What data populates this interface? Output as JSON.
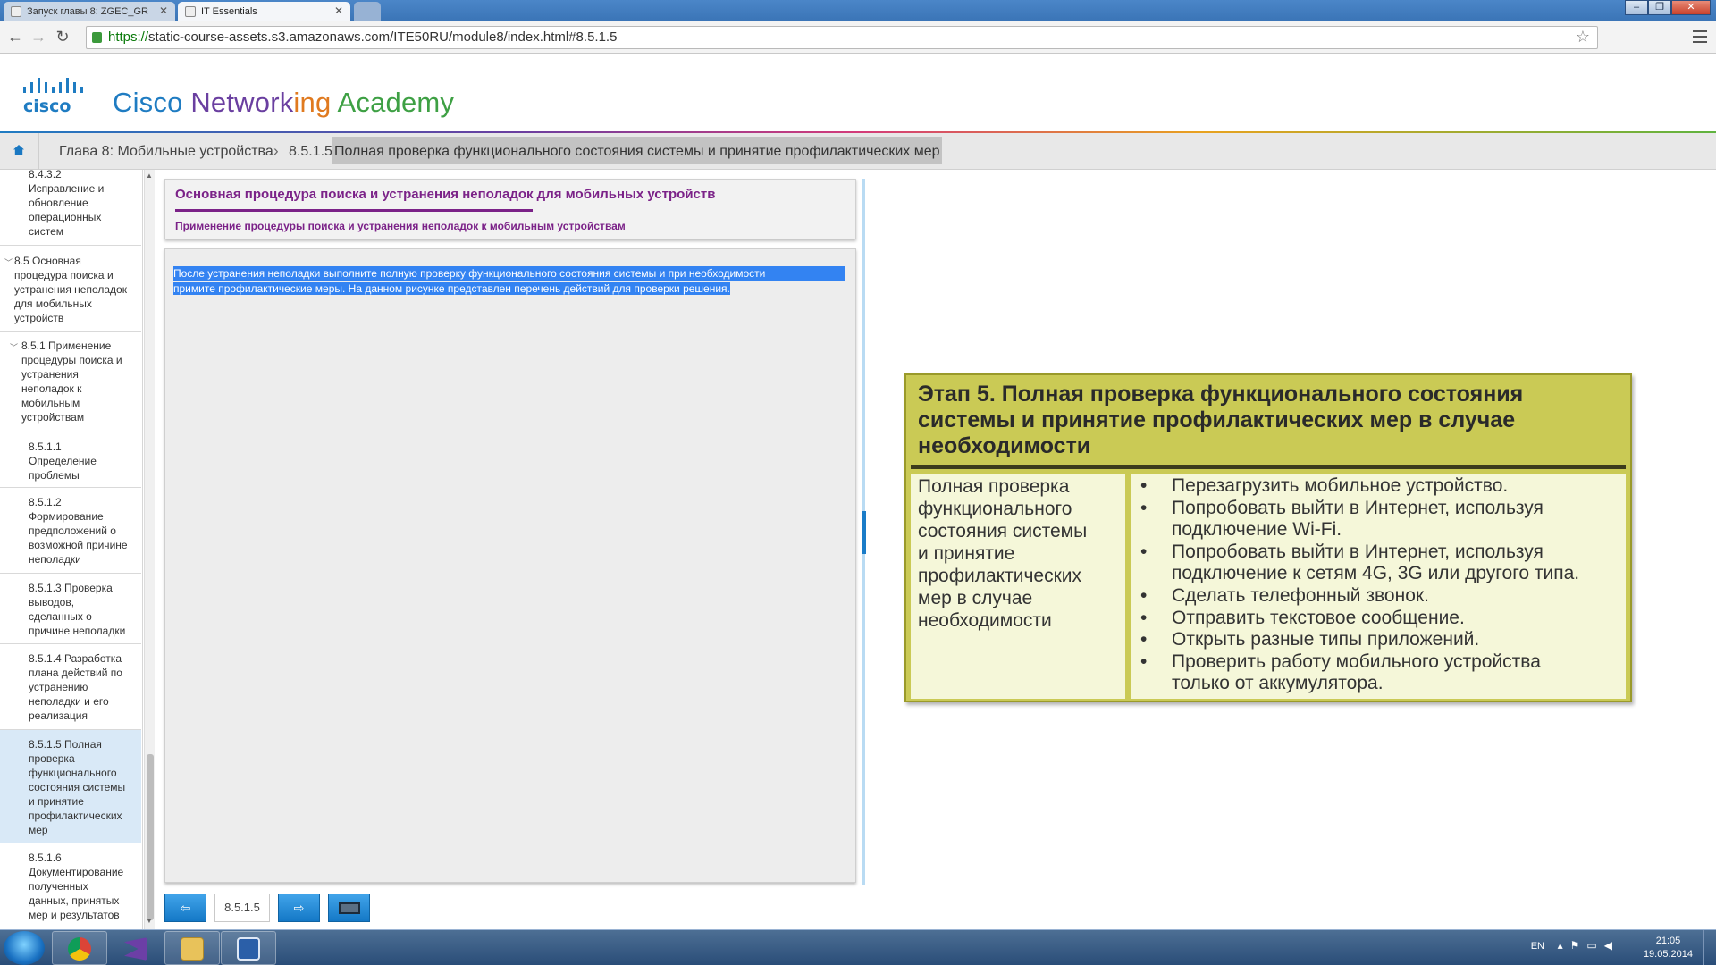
{
  "browser": {
    "tabs": [
      {
        "label": "Запуск главы 8: ZGEC_GR"
      },
      {
        "label": "IT Essentials"
      }
    ],
    "url_https": "https://",
    "url_rest": "static-course-assets.s3.amazonaws.com/ITE50RU/module8/index.html#8.5.1.5"
  },
  "header": {
    "logo_text": "cisco",
    "brand_parts": [
      "Cisco ",
      "Network",
      "ing",
      " Academy"
    ]
  },
  "breadcrumb": {
    "chapter": "Глава 8: Мобильные устройства",
    "separator": "›",
    "current_num": "8.5.1.5",
    "current_title": "Полная проверка функционального состояния системы и принятие профилактических мер"
  },
  "sidebar": {
    "items": [
      {
        "lines": [
          "8.4.3.2",
          "Исправление и",
          "обновление",
          "операционных",
          "систем"
        ]
      },
      {
        "lines": [
          "8.5 Основная",
          "процедура поиска и",
          "устранения неполадок",
          "для мобильных",
          "устройств"
        ]
      },
      {
        "lines": [
          "8.5.1 Применение",
          "процедуры поиска и",
          "устранения",
          "неполадок к",
          "мобильным",
          "устройствам"
        ]
      },
      {
        "lines": [
          "8.5.1.1",
          "Определение",
          "проблемы"
        ]
      },
      {
        "lines": [
          "8.5.1.2",
          "Формирование",
          "предположений о",
          "возможной причине",
          "неполадки"
        ]
      },
      {
        "lines": [
          "8.5.1.3 Проверка",
          "выводов,",
          "сделанных о",
          "причине неполадки"
        ]
      },
      {
        "lines": [
          "8.5.1.4 Разработка",
          "плана действий по",
          "устранению",
          "неполадки и его",
          "реализация"
        ]
      },
      {
        "lines": [
          "8.5.1.5 Полная",
          "проверка",
          "функционального",
          "состояния системы",
          "и принятие",
          "профилактических",
          "мер"
        ]
      },
      {
        "lines": [
          "8.5.1.6",
          "Документирование",
          "полученных",
          "данных, принятых",
          "мер и результатов"
        ]
      }
    ]
  },
  "content": {
    "title": "Основная процедура поиска и устранения неполадок для мобильных устройств",
    "subtitle": "Применение процедуры поиска и устранения неполадок к мобильным устройствам",
    "body_line1": "После устранения неполадки выполните полную проверку функционального состояния системы и при необходимости",
    "body_line2": "примите профилактические меры. На данном рисунке представлен перечень действий для проверки решения."
  },
  "pager": {
    "page": "8.5.1.5"
  },
  "infobox": {
    "title": "Этап 5. Полная проверка функционального состояния системы и принятие профилактических мер в случае необходимости",
    "left_lines": [
      "Полная проверка",
      "функционального",
      "состояния системы",
      "и принятие",
      "профилактических",
      "мер в случае",
      "необходимости"
    ],
    "bullet_char": "•",
    "bullets": [
      [
        "Перезагрузить мобильное устройство."
      ],
      [
        "Попробовать выйти в Интернет, используя",
        "подключение Wi-Fi."
      ],
      [
        "Попробовать выйти в Интернет, используя",
        "подключение к сетям 4G, 3G или другого типа."
      ],
      [
        "Сделать телефонный звонок."
      ],
      [
        "Отправить текстовое сообщение."
      ],
      [
        "Открыть разные типы приложений."
      ],
      [
        "Проверить работу мобильного устройства",
        "только от аккумулятора."
      ]
    ]
  },
  "taskbar": {
    "lang": "EN",
    "time": "21:05",
    "date": "19.05.2014"
  },
  "colors": {
    "accent_purple": "#7b2288",
    "cisco_blue": "#1a78c2",
    "selection_blue": "#3383f2",
    "infobox_olive": "#caca55"
  }
}
